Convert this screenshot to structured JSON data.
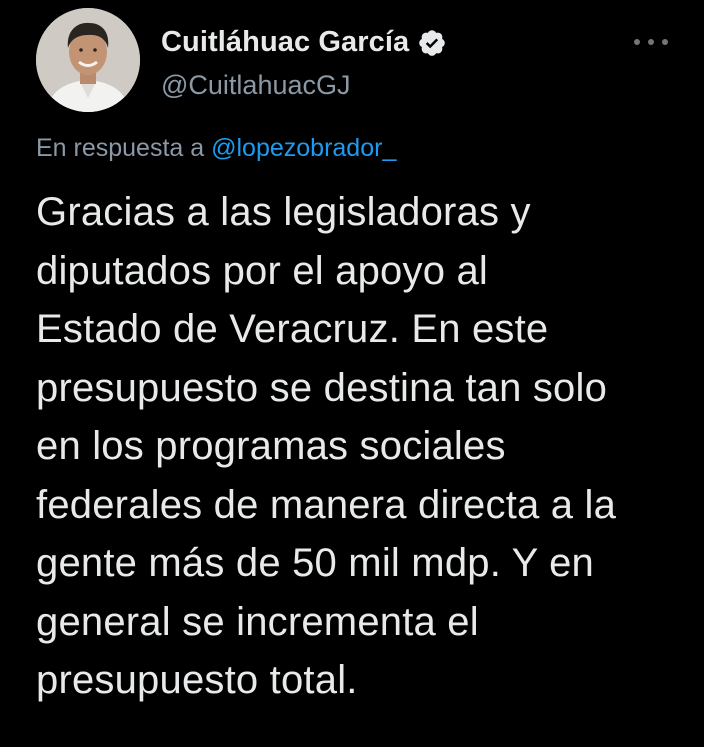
{
  "author": {
    "display_name": "Cuitláhuac García",
    "handle": "@CuitlahuacGJ",
    "verified": true,
    "avatar_icon": "profile-photo",
    "verified_icon": "verified-badge-icon"
  },
  "reply": {
    "prefix": "En respuesta a",
    "mention": "@lopezobrador_"
  },
  "tweet": {
    "text": "Gracias a las legisladoras y\ndiputados por el apoyo al\nEstado de Veracruz. En este\npresupuesto se destina tan solo\nen los programas sociales\nfederales de manera directa a la\ngente más de 50 mil mdp. Y en\ngeneral se incrementa el\npresupuesto total."
  },
  "icons": {
    "more": "more-options-icon"
  },
  "colors": {
    "background": "#000000",
    "text_primary": "#e7e9ea",
    "text_secondary": "#8b98a5",
    "link": "#1d9bf0",
    "verified_badge": "#e7e9ea"
  }
}
